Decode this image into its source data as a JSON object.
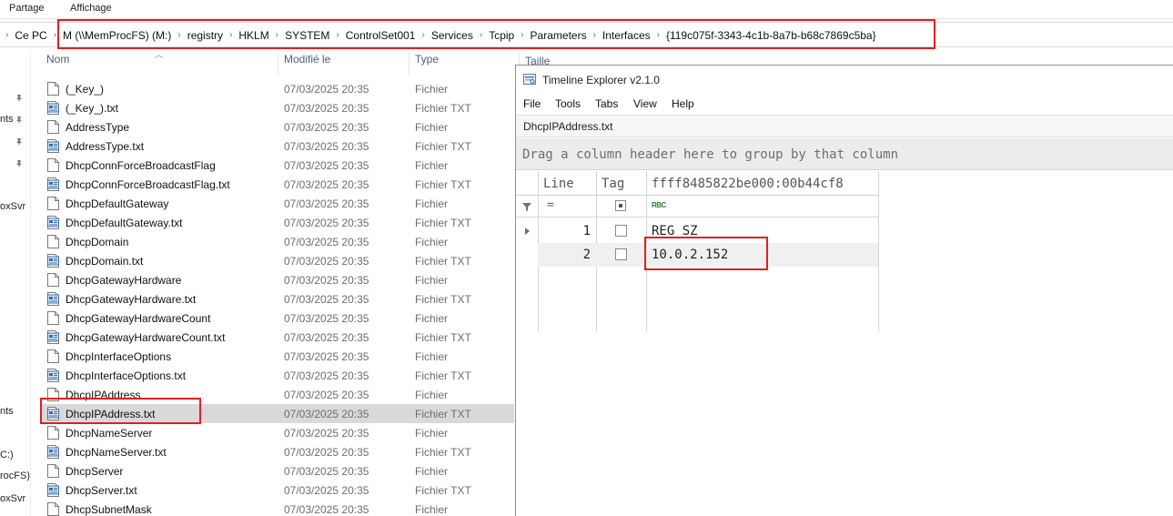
{
  "explorer": {
    "ribbon_tabs": [
      "Partage",
      "Affichage"
    ],
    "breadcrumb": [
      "Ce PC",
      "M (\\\\MemProcFS) (M:)",
      "registry",
      "HKLM",
      "SYSTEM",
      "ControlSet001",
      "Services",
      "Tcpip",
      "Parameters",
      "Interfaces",
      "{119c075f-3343-4c1b-8a7b-b68c7869c5ba}"
    ],
    "left_pane": {
      "labels": [
        "nts",
        "oxSvr",
        "nts",
        "C:)",
        "rocFS) (",
        "oxSvr"
      ]
    },
    "columns": {
      "name": "Nom",
      "modified": "Modifié le",
      "type": "Type",
      "size": "Taille"
    },
    "files": [
      {
        "name": "(_Key_)",
        "date": "07/03/2025 20:35",
        "type": "Fichier",
        "icon": "blank-file-icon"
      },
      {
        "name": "(_Key_).txt",
        "date": "07/03/2025 20:35",
        "type": "Fichier TXT",
        "icon": "text-file-icon"
      },
      {
        "name": "AddressType",
        "date": "07/03/2025 20:35",
        "type": "Fichier",
        "icon": "blank-file-icon"
      },
      {
        "name": "AddressType.txt",
        "date": "07/03/2025 20:35",
        "type": "Fichier TXT",
        "icon": "text-file-icon"
      },
      {
        "name": "DhcpConnForceBroadcastFlag",
        "date": "07/03/2025 20:35",
        "type": "Fichier",
        "icon": "blank-file-icon"
      },
      {
        "name": "DhcpConnForceBroadcastFlag.txt",
        "date": "07/03/2025 20:35",
        "type": "Fichier TXT",
        "icon": "text-file-icon"
      },
      {
        "name": "DhcpDefaultGateway",
        "date": "07/03/2025 20:35",
        "type": "Fichier",
        "icon": "blank-file-icon"
      },
      {
        "name": "DhcpDefaultGateway.txt",
        "date": "07/03/2025 20:35",
        "type": "Fichier TXT",
        "icon": "text-file-icon"
      },
      {
        "name": "DhcpDomain",
        "date": "07/03/2025 20:35",
        "type": "Fichier",
        "icon": "blank-file-icon"
      },
      {
        "name": "DhcpDomain.txt",
        "date": "07/03/2025 20:35",
        "type": "Fichier TXT",
        "icon": "text-file-icon"
      },
      {
        "name": "DhcpGatewayHardware",
        "date": "07/03/2025 20:35",
        "type": "Fichier",
        "icon": "blank-file-icon"
      },
      {
        "name": "DhcpGatewayHardware.txt",
        "date": "07/03/2025 20:35",
        "type": "Fichier TXT",
        "icon": "text-file-icon"
      },
      {
        "name": "DhcpGatewayHardwareCount",
        "date": "07/03/2025 20:35",
        "type": "Fichier",
        "icon": "blank-file-icon"
      },
      {
        "name": "DhcpGatewayHardwareCount.txt",
        "date": "07/03/2025 20:35",
        "type": "Fichier TXT",
        "icon": "text-file-icon"
      },
      {
        "name": "DhcpInterfaceOptions",
        "date": "07/03/2025 20:35",
        "type": "Fichier",
        "icon": "blank-file-icon"
      },
      {
        "name": "DhcpInterfaceOptions.txt",
        "date": "07/03/2025 20:35",
        "type": "Fichier TXT",
        "icon": "text-file-icon"
      },
      {
        "name": "DhcpIPAddress",
        "date": "07/03/2025 20:35",
        "type": "Fichier",
        "icon": "blank-file-icon"
      },
      {
        "name": "DhcpIPAddress.txt",
        "date": "07/03/2025 20:35",
        "type": "Fichier TXT",
        "icon": "text-file-icon",
        "selected": true
      },
      {
        "name": "DhcpNameServer",
        "date": "07/03/2025 20:35",
        "type": "Fichier",
        "icon": "blank-file-icon"
      },
      {
        "name": "DhcpNameServer.txt",
        "date": "07/03/2025 20:35",
        "type": "Fichier TXT",
        "icon": "text-file-icon"
      },
      {
        "name": "DhcpServer",
        "date": "07/03/2025 20:35",
        "type": "Fichier",
        "icon": "blank-file-icon"
      },
      {
        "name": "DhcpServer.txt",
        "date": "07/03/2025 20:35",
        "type": "Fichier TXT",
        "icon": "text-file-icon"
      },
      {
        "name": "DhcpSubnetMask",
        "date": "07/03/2025 20:35",
        "type": "Fichier",
        "icon": "blank-file-icon"
      }
    ]
  },
  "timeline": {
    "title": "Timeline Explorer v2.1.0",
    "menu": [
      "File",
      "Tools",
      "Tabs",
      "View",
      "Help"
    ],
    "tab": "DhcpIPAddress.txt",
    "group_hint": "Drag a column header here to group by that column",
    "headers": {
      "line": "Line",
      "tag": "Tag",
      "value": "ffff8485822be000:00b44cf8"
    },
    "filter": {
      "line_op": "=",
      "value_type": "RBC"
    },
    "rows": [
      {
        "line": "1",
        "value": "REG_SZ"
      },
      {
        "line": "2",
        "value": "10.0.2.152"
      }
    ]
  },
  "colors": {
    "highlight_red": "#e02020",
    "selected_row": "#d9d9d9",
    "header_text": "#4c607a"
  }
}
